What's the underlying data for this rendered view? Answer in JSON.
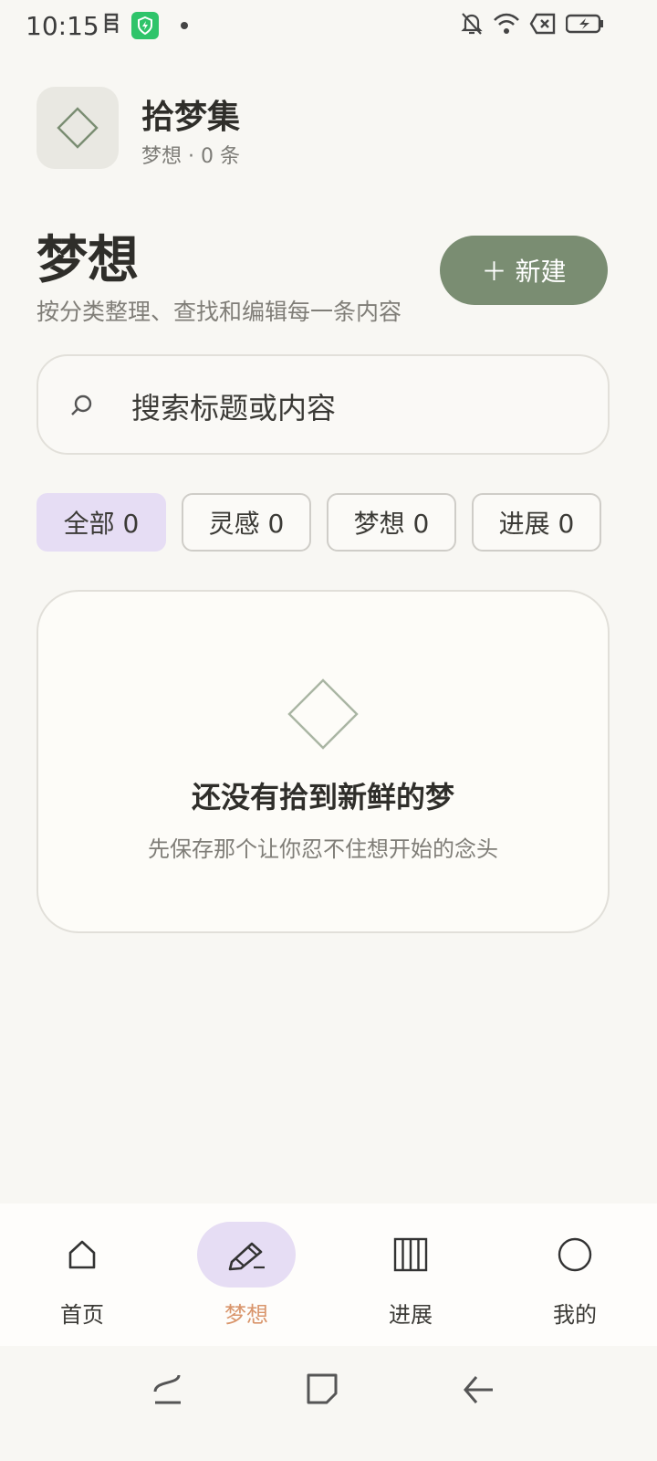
{
  "status_bar": {
    "time": "10:15",
    "left_icons": [
      "sim-icon",
      "shield-icon",
      "notification-dot-icon"
    ],
    "right_icons": [
      "bell-off-icon",
      "wifi-icon",
      "no-sim-icon",
      "battery-charging-icon"
    ]
  },
  "app": {
    "title": "拾梦集",
    "subtitle": "梦想 · 0 条",
    "logo_icon": "diamond-icon"
  },
  "page": {
    "title": "梦想",
    "description": "按分类整理、查找和编辑每一条内容",
    "new_button_label": "＋ 新建"
  },
  "search": {
    "placeholder": "搜索标题或内容"
  },
  "filters": [
    {
      "label": "全部 0",
      "active": true
    },
    {
      "label": "灵感 0",
      "active": false
    },
    {
      "label": "梦想 0",
      "active": false
    },
    {
      "label": "进展 0",
      "active": false
    }
  ],
  "empty_state": {
    "title": "还没有拾到新鲜的梦",
    "subtitle": "先保存那个让你忍不住想开始的念头"
  },
  "bottom_nav": [
    {
      "label": "首页",
      "icon": "home-icon",
      "active": false
    },
    {
      "label": "梦想",
      "icon": "pencil-icon",
      "active": true
    },
    {
      "label": "进展",
      "icon": "columns-icon",
      "active": false
    },
    {
      "label": "我的",
      "icon": "profile-circle-icon",
      "active": false
    }
  ],
  "colors": {
    "background": "#f8f7f3",
    "accent_green": "#7a8d72",
    "active_lavender": "#e6ddf4",
    "active_nav_label": "#d9956b"
  }
}
